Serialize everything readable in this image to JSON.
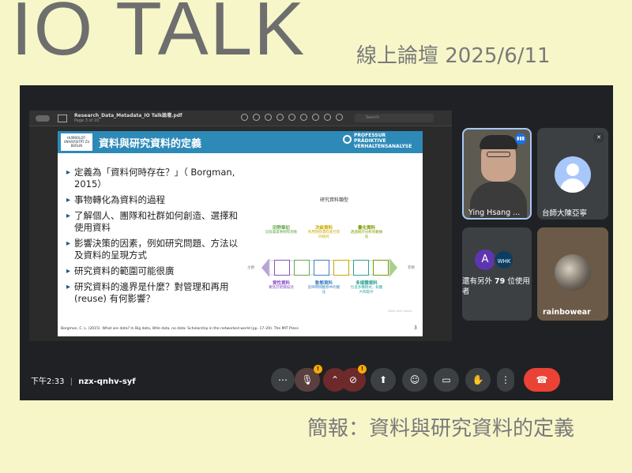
{
  "header": {
    "title": "IO TALK",
    "subtitle": "線上論壇 2025/6/11"
  },
  "footer": {
    "caption": "簡報：資料與研究資料的定義"
  },
  "pdf_viewer": {
    "file_name": "Research_Data_Metadata_IO Talk論壇.pdf",
    "page_indicator": "Page 3 of 10",
    "search_placeholder": "Search"
  },
  "slide": {
    "title": "資料與研究資料的定義",
    "logo_left": "HUMBOLDT-UNIVERSITÄT ZU BERLIN",
    "logo_right": [
      "PROFESSUR",
      "PRÄDIKTIVE",
      "VERHALTENSANALYSE"
    ],
    "bullets": [
      "定義為「資料何時存在？」（ Borgman, 2015）",
      "事物轉化為資料的過程",
      "了解個人、團隊和社群如何創造、選擇和使用資料",
      "影響決策的因素，例如研究問題、方法以及資料的呈現方式",
      "研究資料的範圍可能很廣",
      "研究資料的邊界是什麼？對管理和再用 (reuse) 有何影響？"
    ],
    "footer_ref": "Borgman, C. L. (2015). What are data? In Big data, little data, no data: Scholarship in the networked world (pp. 17–29). The MIT Press",
    "page_number": "3",
    "diagram": {
      "title": "研究資料類型",
      "left_label": "主觀",
      "right_label": "客觀",
      "top_items": [
        {
          "name": "田野筆記",
          "desc": "記錄農業事物和現象"
        },
        {
          "name": "次級資料",
          "desc": "利用現有資料進行新的研究"
        },
        {
          "name": "量化資料",
          "desc": "透過統計分析的數據化"
        }
      ],
      "bottom_items": [
        {
          "name": "質性資料",
          "desc": "聚焦於經驗描述"
        },
        {
          "name": "動態資料",
          "desc": "反映時間推移中的變化"
        },
        {
          "name": "多媒體資料",
          "desc": "包含多種格式，如圖片和影片"
        }
      ],
      "credit": "Made with Napkin"
    }
  },
  "participants": [
    {
      "name": "Ying Hsang ...",
      "status": "speaking"
    },
    {
      "name": "台師大陳亞寧",
      "status": "muted"
    },
    {
      "name": "rainbowear"
    }
  ],
  "others_tile": {
    "avatar_a": "A",
    "avatar_b": "WHK",
    "text_prefix": "還有另外",
    "count": "79",
    "text_suffix": "位使用者"
  },
  "bottom_bar": {
    "time": "下午2:33",
    "separator": "|",
    "meeting_code": "nzx-qnhv-syf"
  },
  "colors": {
    "background": "#f7f6c9",
    "meet_bg": "#202124",
    "slide_header": "#2d8ab8",
    "end_call": "#ea4335",
    "warning": "#f9ab00"
  }
}
